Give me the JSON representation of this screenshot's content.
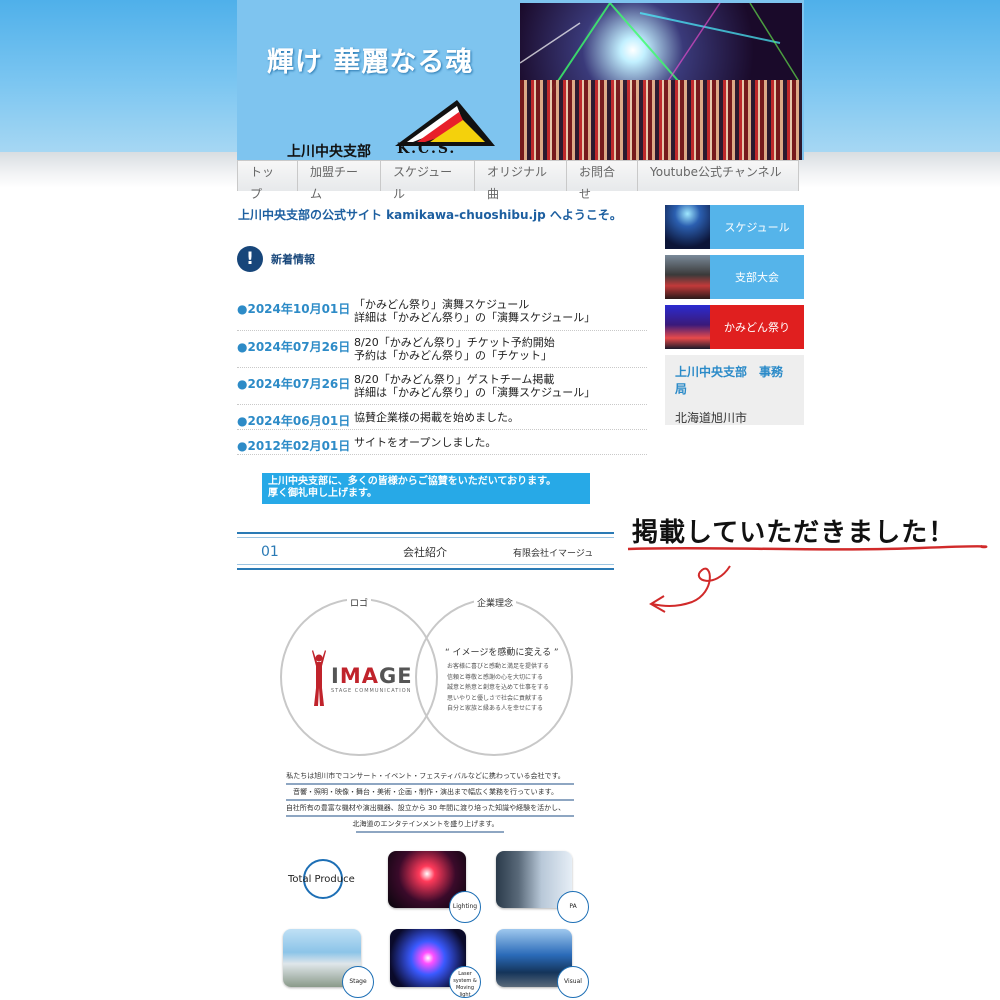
{
  "header": {
    "title": "輝け 華麗なる魂",
    "branch": "上川中央支部",
    "logo_text": "K.C.S."
  },
  "nav": {
    "items": [
      "トップ",
      "加盟チーム",
      "スケジュール",
      "オリジナル曲",
      "お問合せ",
      "Youtube公式チャンネル"
    ]
  },
  "welcome": "上川中央支部の公式サイト kamikawa-chuoshibu.jp へようこそ。",
  "news": {
    "heading": "新着情報",
    "items": [
      {
        "date": "●2024年10月01日",
        "line1": "「かみどん祭り」演舞スケジュール",
        "line2": "詳細は「かみどん祭り」の「演舞スケジュール」"
      },
      {
        "date": "●2024年07月26日",
        "line1": "8/20「かみどん祭り」チケット予約開始",
        "line2": "予約は「かみどん祭り」の「チケット」"
      },
      {
        "date": "●2024年07月26日",
        "line1": "8/20「かみどん祭り」ゲストチーム掲載",
        "line2": "詳細は「かみどん祭り」の「演舞スケジュール」"
      },
      {
        "date": "●2024年06月01日",
        "line1": "協賛企業様の掲載を始めました。",
        "line2": ""
      },
      {
        "date": "●2012年02月01日",
        "line1": "サイトをオープンしました。",
        "line2": ""
      }
    ]
  },
  "thanks": {
    "line1": "上川中央支部に、多くの皆様からご協賛をいただいております。",
    "line2": "厚く御礼申し上げます。"
  },
  "sidebar": {
    "buttons": [
      {
        "label": "スケジュール",
        "color": "#55b4ea"
      },
      {
        "label": "支部大会",
        "color": "#55b4ea"
      },
      {
        "label": "かみどん祭り",
        "color": "#e01f1f"
      }
    ],
    "office_title": "上川中央支部　事務局",
    "office_address": "北海道旭川市"
  },
  "annotation": "掲載していただきました！",
  "sponsor": {
    "number": "01",
    "title": "会社紹介",
    "company": "有限会社イマージュ",
    "logo_label": "ロゴ",
    "philosophy_label": "企業理念",
    "logo_main": "IMAGE",
    "logo_sub": "STAGE COMMUNICATION",
    "motto": "“ イメージを感動に変える ”",
    "philosophy_lines": [
      "お客様に喜びと感動と満足を提供する",
      "信頼と尊敬と感謝の心を大切にする",
      "誠意と熱意と創意を込めて仕事をする",
      "思いやりと優しさで社会に貢献する",
      "自分と家族と縁ある人を幸せにする"
    ],
    "description": [
      "私たちは旭川市でコンサート・イベント・フェスティバルなどに携わっている会社です。",
      "音響・照明・映像・舞台・美術・企画・制作・演出まで幅広く業務を行っています。",
      "自社所有の豊富な機材や演出機器、設立から 30 年間に渡り培った知識や経験を活かし、",
      "北海道のエンタテインメントを盛り上げます。"
    ],
    "total_produce": "Total Produce",
    "services": [
      "Lighting",
      "PA",
      "Stage",
      "Laser system & Moving light",
      "Visual"
    ]
  },
  "colors": {
    "accent": "#2a8ac8",
    "navy": "#17467a",
    "red": "#e01f1f"
  }
}
